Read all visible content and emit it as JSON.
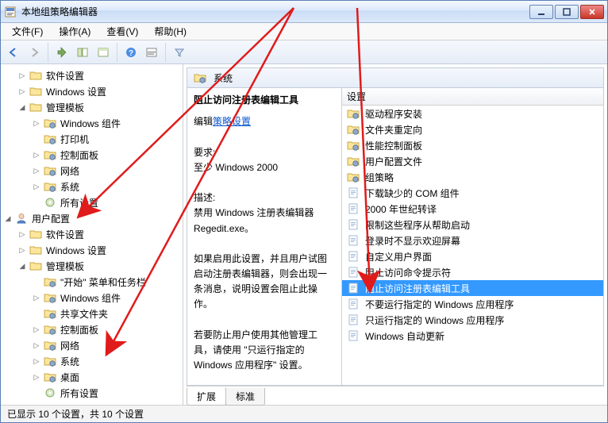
{
  "window": {
    "title": "本地组策略编辑器"
  },
  "menu": {
    "file": "文件(F)",
    "action": "操作(A)",
    "view": "查看(V)",
    "help": "帮助(H)"
  },
  "tree": {
    "n1": "软件设置",
    "n2": "Windows 设置",
    "n3": "管理模板",
    "n3_1": "Windows 组件",
    "n3_2": "打印机",
    "n3_3": "控制面板",
    "n3_4": "网络",
    "n3_5": "系统",
    "n3_6": "所有设置",
    "user": "用户配置",
    "u1": "软件设置",
    "u2": "Windows 设置",
    "u3": "管理模板",
    "u3_1": "\"开始\" 菜单和任务栏",
    "u3_2": "Windows 组件",
    "u3_3": "共享文件夹",
    "u3_4": "控制面板",
    "u3_5": "网络",
    "u3_6": "系统",
    "u3_7": "桌面",
    "u3_8": "所有设置"
  },
  "pathHeader": "系统",
  "details": {
    "title": "阻止访问注册表编辑工具",
    "editLabelA": "编辑",
    "editLabelB": "策略设置",
    "reqHeader": "要求:",
    "reqBody": "至少 Windows 2000",
    "descHeader": "描述:",
    "desc1": "禁用 Windows 注册表编辑器 Regedit.exe。",
    "desc2": "如果启用此设置，并且用户试图启动注册表编辑器，则会出现一条消息，说明设置会阻止此操作。",
    "desc3": "若要防止用户使用其他管理工具，请使用 \"只运行指定的 Windows 应用程序\" 设置。"
  },
  "list": {
    "header": "设置",
    "items": {
      "i0": "驱动程序安装",
      "i1": "文件夹重定向",
      "i2": "性能控制面板",
      "i3": "用户配置文件",
      "i4": "组策略",
      "i5": "下载缺少的 COM 组件",
      "i6": "2000 年世纪转译",
      "i7": "限制这些程序从帮助启动",
      "i8": "登录时不显示欢迎屏幕",
      "i9": "自定义用户界面",
      "i10": "阻止访问命令提示符",
      "i11": "阻止访问注册表编辑工具",
      "i12": "不要运行指定的 Windows 应用程序",
      "i13": "只运行指定的 Windows 应用程序",
      "i14": "Windows 自动更新"
    }
  },
  "tabs": {
    "extend": "扩展",
    "standard": "标准"
  },
  "status": "已显示 10 个设置，共 10 个设置"
}
